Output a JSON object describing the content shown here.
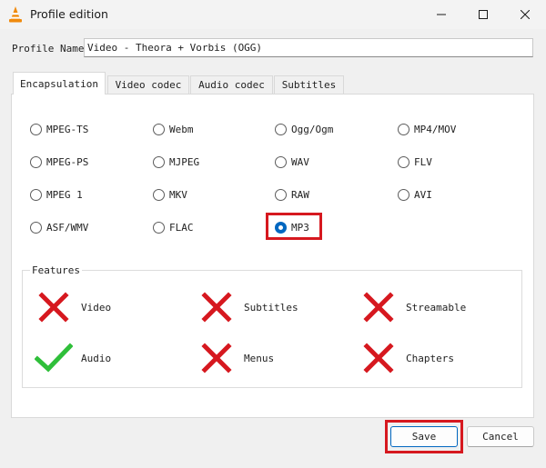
{
  "window": {
    "title": "Profile edition"
  },
  "profile": {
    "label": "Profile Name",
    "value": "Video - Theora + Vorbis (OGG)"
  },
  "tabs": [
    {
      "label": "Encapsulation",
      "active": true
    },
    {
      "label": "Video codec",
      "active": false
    },
    {
      "label": "Audio codec",
      "active": false
    },
    {
      "label": "Subtitles",
      "active": false
    }
  ],
  "encapsulation": {
    "options": [
      {
        "label": "MPEG-TS",
        "checked": false
      },
      {
        "label": "Webm",
        "checked": false
      },
      {
        "label": "Ogg/Ogm",
        "checked": false
      },
      {
        "label": "MP4/MOV",
        "checked": false
      },
      {
        "label": "MPEG-PS",
        "checked": false
      },
      {
        "label": "MJPEG",
        "checked": false
      },
      {
        "label": "WAV",
        "checked": false
      },
      {
        "label": "FLV",
        "checked": false
      },
      {
        "label": "MPEG 1",
        "checked": false
      },
      {
        "label": "MKV",
        "checked": false
      },
      {
        "label": "RAW",
        "checked": false
      },
      {
        "label": "AVI",
        "checked": false
      },
      {
        "label": "ASF/WMV",
        "checked": false
      },
      {
        "label": "FLAC",
        "checked": false
      },
      {
        "label": "MP3",
        "checked": true
      }
    ]
  },
  "features": {
    "title": "Features",
    "items": [
      {
        "label": "Video",
        "supported": false
      },
      {
        "label": "Subtitles",
        "supported": false
      },
      {
        "label": "Streamable",
        "supported": false
      },
      {
        "label": "Audio",
        "supported": true
      },
      {
        "label": "Menus",
        "supported": false
      },
      {
        "label": "Chapters",
        "supported": false
      }
    ]
  },
  "buttons": {
    "save": "Save",
    "cancel": "Cancel"
  },
  "colors": {
    "accent": "#0067c0",
    "cross": "#d6181f",
    "check": "#2fbf3a",
    "highlight": "#d6181f"
  }
}
